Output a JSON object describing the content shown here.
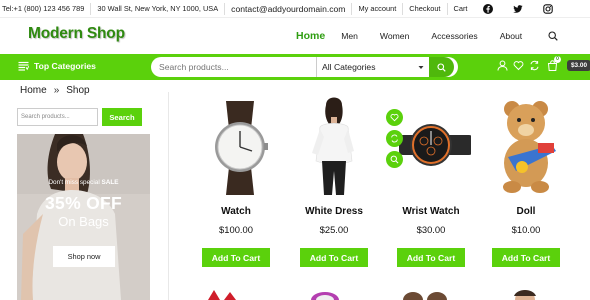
{
  "topbar": {
    "phone": "Tel:+1 (800) 123 456 789",
    "address": "30 Wall St, New York, NY 1000, USA",
    "email": "contact@addyourdomain.com",
    "links": [
      "My account",
      "Checkout",
      "Cart"
    ],
    "social_icons": [
      "facebook-icon",
      "twitter-icon",
      "instagram-icon"
    ]
  },
  "header": {
    "logo_part1": "Modern",
    "logo_part2": "Shop",
    "nav": [
      "Home",
      "Men",
      "Women",
      "Accessories",
      "About"
    ]
  },
  "category_bar": {
    "title": "Top Categories",
    "search_placeholder": "Search products...",
    "category_select": "All Categories",
    "cart_count": "0",
    "cart_total": "$3.00"
  },
  "breadcrumb": {
    "home": "Home",
    "separator": "»",
    "current": "Shop"
  },
  "sidebar": {
    "search_placeholder": "Search products...",
    "search_button": "Search",
    "banner": {
      "line1_a": "Don't miss special",
      "line1_b": "SALE",
      "headline": "35% OFF",
      "subline": "On Bags",
      "button": "Shop now"
    }
  },
  "products": [
    {
      "name": "Watch",
      "price": "$100.00",
      "button": "Add To Cart"
    },
    {
      "name": "White Dress",
      "price": "$25.00",
      "button": "Add To Cart"
    },
    {
      "name": "Wrist Watch",
      "price": "$30.00",
      "button": "Add To Cart"
    },
    {
      "name": "Doll",
      "price": "$10.00",
      "button": "Add To Cart"
    }
  ],
  "colors": {
    "brand_green": "#5bd10c",
    "logo_green": "#2f8a10",
    "nav_active": "#2f9e12"
  }
}
